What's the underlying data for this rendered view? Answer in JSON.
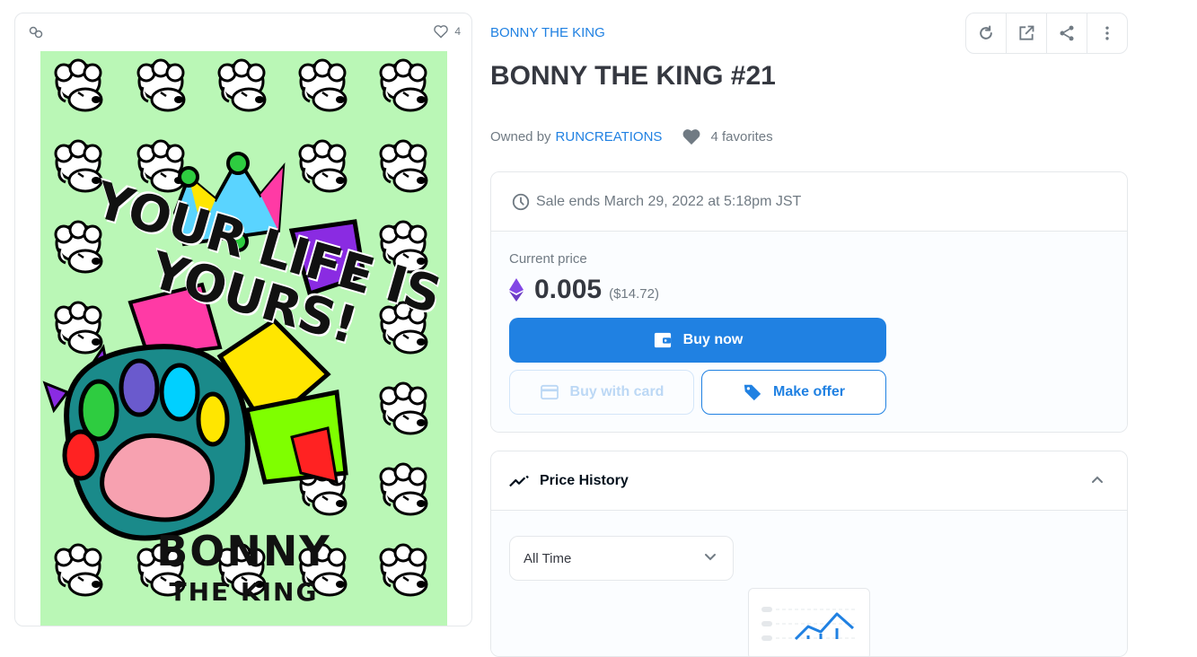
{
  "image_card": {
    "favorite_count": "4"
  },
  "artwork": {
    "line1": "YOUR LIFE IS",
    "line2": "YOURS!",
    "bottom1": "BONNY",
    "bottom2": "THE KING"
  },
  "collection_name": "BONNY THE KING",
  "toolbar": {
    "icons": [
      "refresh-icon",
      "external-link-icon",
      "share-icon",
      "more-vertical-icon"
    ]
  },
  "title": "BONNY THE KING #21",
  "owner": {
    "prefix": "Owned by",
    "name": "RUNCREATIONS",
    "favorites": "4 favorites"
  },
  "sale": {
    "ends_text": "Sale ends March 29, 2022 at 5:18pm JST"
  },
  "price": {
    "label": "Current price",
    "amount": "0.005",
    "usd": "($14.72)"
  },
  "buttons": {
    "buy_now": "Buy now",
    "buy_with_card": "Buy with card",
    "make_offer": "Make offer"
  },
  "price_history": {
    "title": "Price History",
    "range": "All Time"
  },
  "colors": {
    "accent": "#2081e2",
    "text": "#353840",
    "muted": "#707a83",
    "border": "#e5e8eb",
    "art_bg": "#baf7b6"
  }
}
